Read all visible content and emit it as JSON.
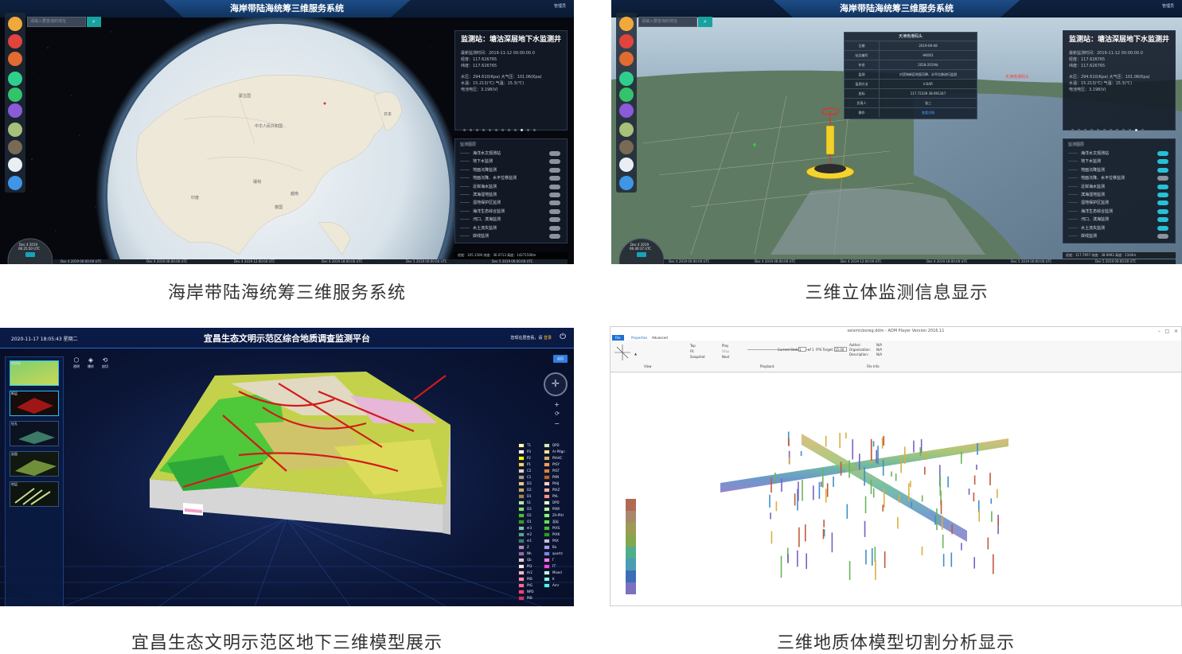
{
  "panels": [
    {
      "id": "coastal",
      "app_title": "海岸带陆海统筹三维服务系统",
      "user_link": "管理员",
      "search_placeholder": "请输入要查询的地址",
      "station": {
        "title": "监测站：塘沽深层地下水监测井",
        "rows": [
          "最新监测时间：2019-11-12 00:00:00.0",
          "经度：117.626765",
          "纬度：117.626765",
          "水压：294.610(Kpa)  大气压：101.06(Kpa)",
          "水温：15.213(℃)  气温：15.3(℃)",
          "电池电压：3.198(V)"
        ]
      },
      "layers_heading": "监测图层",
      "layers": [
        "海洋水文观测站",
        "地下水监测",
        "地面沉降监测",
        "地面沉降、水平位移监测",
        "近岸海水监测",
        "滨海湿地监测",
        "湿地保护区监测",
        "海洋生态综合监测",
        "河口、滨海监测",
        "水土流失监测",
        "岸线监测"
      ],
      "layer_toggle_states": [
        false,
        false,
        false,
        false,
        false,
        false,
        false,
        false,
        false,
        false,
        false
      ],
      "status_bar": "经度：105.1506  纬度：36.0713  高度：14271506m",
      "date_label": "Dec 4 2019",
      "time_label": "06:25:50 UTC",
      "timeline": [
        "Dec 4 2019 00:00:00 UTC",
        "Dec 4 2019 06:00:00 UTC",
        "Dec 4 2019 12:00:00 UTC",
        "Dec 4 2019 18:00:00 UTC",
        "Dec 5 2019 00:00:00 UTC",
        "Dec 5 2019 06:00:00 UTC"
      ],
      "map_labels": [
        "中华人民共和国",
        "蒙古国",
        "日本",
        "印度",
        "泰国",
        "越南",
        "缅甸"
      ]
    },
    {
      "id": "monitor",
      "app_title": "海岸带陆海统筹三维服务系统",
      "user_link": "管理员",
      "search_placeholder": "请输入要查询的地址",
      "popup": {
        "title": "天津南港码头",
        "rows": [
          [
            "日期",
            "2019-09-08"
          ],
          [
            "站点编号",
            "HK001"
          ],
          [
            "年份",
            "2018-2019年"
          ],
          [
            "监测",
            "对滨海新区地面沉降、水平位移进行监测"
          ],
          [
            "监测方法",
            "InSAR"
          ],
          [
            "坐标",
            "117.72339 38.991347"
          ],
          [
            "负责人",
            "张三"
          ],
          [
            "操作",
            "查看详情"
          ]
        ]
      },
      "station": {
        "title": "监测站：塘沽深层地下水监测井",
        "rows": [
          "最新监测时间：2019-11-12 00:00:00.0",
          "经度：117.626765",
          "纬度：117.626765",
          "水压：294.610(Kpa)  大气压：101.06(Kpa)",
          "水温：15.213(℃)  气温：15.3(℃)",
          "电池电压：3.198(V)"
        ]
      },
      "layers_heading": "监测图层",
      "layers": [
        "海洋水文观测站",
        "地下水监测",
        "地面沉降监测",
        "地面沉降、水平位移监测",
        "近岸海水监测",
        "滨海湿地监测",
        "湿地保护区监测",
        "海洋生态综合监测",
        "河口、滨海监测",
        "水土流失监测",
        "岸线监测"
      ],
      "layer_toggle_states": [
        true,
        true,
        true,
        false,
        true,
        true,
        true,
        true,
        true,
        true,
        false
      ],
      "status_bar": "经度：117.7957  纬度：38.9992  高度：1104m",
      "date_label": "Dec 4 2019",
      "time_label": "06:40:37 UTC",
      "timeline": [
        "Dec 4 2019 00:00:00 UTC",
        "Dec 4 2019 06:00:00 UTC",
        "Dec 4 2019 12:00:00 UTC",
        "Dec 4 2019 18:00:00 UTC",
        "Dec 5 2019 00:00:00 UTC",
        "Dec 5 2019 06:00:00 UTC"
      ],
      "map_label": "天津南港码头"
    },
    {
      "id": "yichang",
      "app_title": "宜昌生态文明示范区综合地质调查监测平台",
      "datetime": "2020-11-17 18:05:43 星期二",
      "welcome": "您现在居查看，请",
      "login_link": "登录",
      "thumbnails": [
        "地质体",
        "断层",
        "钻孔",
        "剖面",
        "地层"
      ],
      "tools": [
        {
          "icon": "⬡",
          "label": "透明"
        },
        {
          "icon": "◈",
          "label": "爆炸"
        },
        {
          "icon": "⟲",
          "label": "剖切"
        }
      ],
      "top_button": "返回",
      "legend_left": [
        "T1",
        "P3",
        "P2",
        "P1",
        "C2",
        "C1",
        "D3",
        "D2",
        "D1",
        "S1",
        "O3",
        "O2",
        "O1",
        "∈3",
        "∈2",
        "∈1",
        "Z",
        "Nh",
        "Qb",
        "Pt2",
        "Ar2",
        "PtB",
        "PtG",
        "NPD",
        "PtB"
      ],
      "legend_right": [
        "DPD",
        "Ar-PtIgn",
        "PthHC",
        "PtSY",
        "PtST",
        "PtIN",
        "PtHJ",
        "PthZ",
        "PtIL",
        "DPD",
        "PtIW",
        "ZA-PtH",
        "混岩",
        "PtXS",
        "PtXK",
        "PtIX",
        "Ba",
        "quartz",
        "Γ",
        "ΓΓ",
        "Mixed",
        "K",
        "Amr"
      ],
      "legend_left_colors": [
        "#fefeb8",
        "#ffffff",
        "#ffff00",
        "#f5d076",
        "#d7d7d7",
        "#9a9a9a",
        "#e6c88c",
        "#c2a870",
        "#a0825a",
        "#b4e6b4",
        "#7ce07c",
        "#43c043",
        "#2f9e2f",
        "#80c0c0",
        "#5aa0a0",
        "#2f7f7f",
        "#aa8ad8",
        "#8c6ab4",
        "#d8c8e8",
        "#eeeeee",
        "#ffb4d8",
        "#ff8cc0",
        "#ff64a8",
        "#ff3c90",
        "#e02878"
      ],
      "legend_right_colors": [
        "#c8f0c8",
        "#ffe0a0",
        "#d0b080",
        "#f0a060",
        "#e08040",
        "#c06030",
        "#ffd0d0",
        "#ffb0b0",
        "#ff9090",
        "#e0ffe0",
        "#b0ffb0",
        "#80ff80",
        "#60e060",
        "#40c040",
        "#20a020",
        "#c0c0ff",
        "#a0a0ff",
        "#8080ff",
        "#ff80ff",
        "#ff40ff",
        "#c0ffff",
        "#80ffff",
        "#40ffff"
      ]
    },
    {
      "id": "cutting",
      "window_title": "seismicboreg.ddm - ADM Player Version 2016.11",
      "tabs": [
        "File",
        "Properties",
        "Advanced"
      ],
      "ribbon_items": [
        "Top",
        "Fit",
        "Snapshot",
        "Play",
        "Stop",
        "Next"
      ],
      "current_state_label": "Current State:",
      "current_state_value": "1",
      "of_label": "of 1",
      "fps_label": "FPS Target:",
      "fps_value": "15.00",
      "author_label": "Author:",
      "organization_label": "Organization:",
      "description_label": "Description:",
      "info_value": "N/A",
      "group_labels": [
        "View",
        "Playback",
        "File Info"
      ],
      "colorbar": [
        "#b06a53",
        "#a8886a",
        "#9c9a55",
        "#83a64f",
        "#4fae8c",
        "#4e9cb3",
        "#3b6eb7",
        "#7b71c0"
      ]
    }
  ],
  "captions": [
    "海岸带陆海统筹三维服务系统",
    "三维立体监测信息显示",
    "宜昌生态文明示范区地下三维模型展示",
    "三维地质体模型切割分析显示"
  ]
}
